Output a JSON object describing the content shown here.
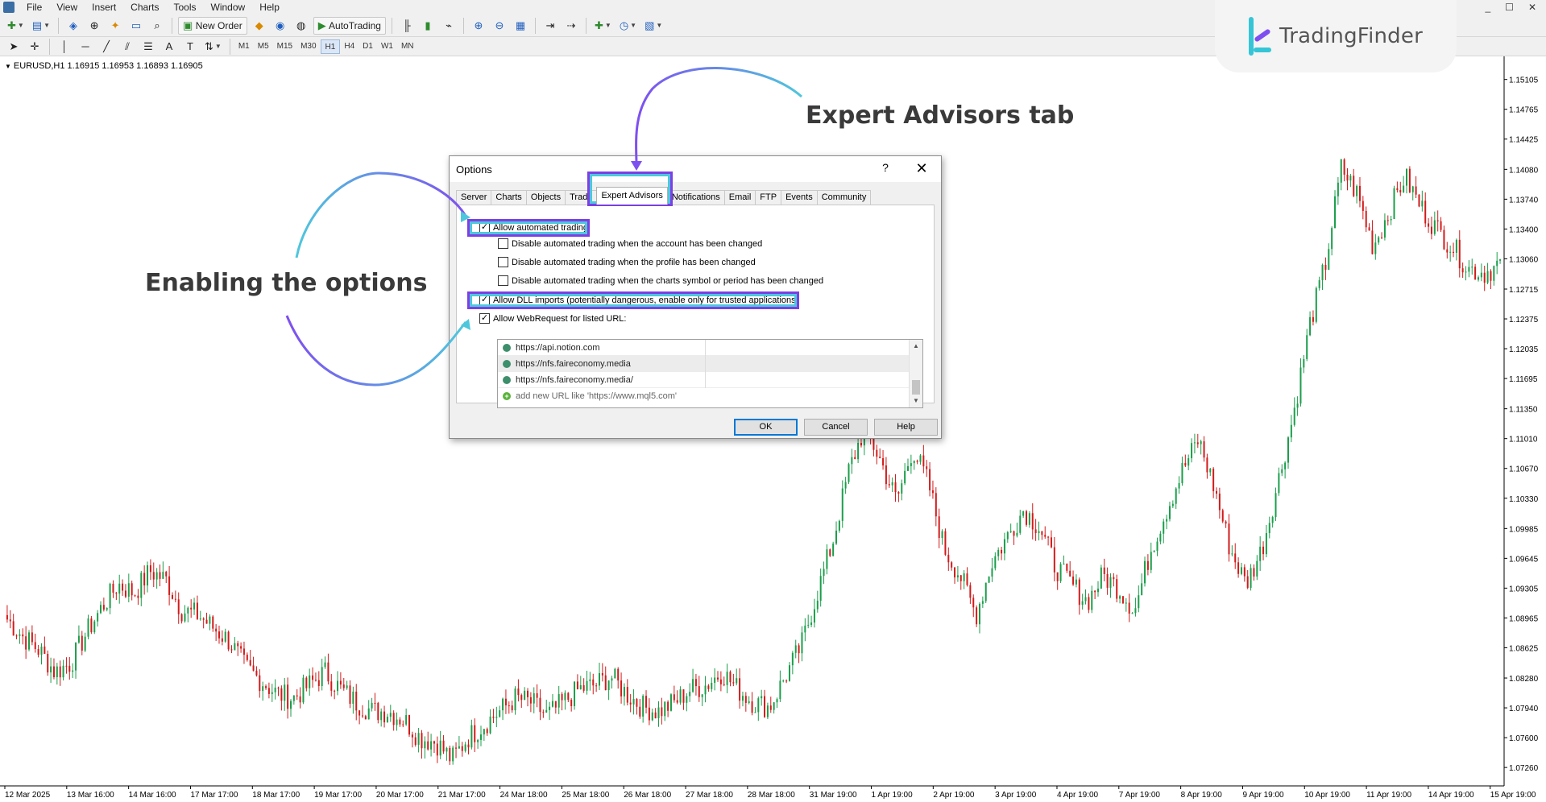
{
  "menu": {
    "items": [
      "File",
      "View",
      "Insert",
      "Charts",
      "Tools",
      "Window",
      "Help"
    ]
  },
  "window_controls": [
    "_",
    "☐",
    "✕"
  ],
  "toolbar": {
    "new_order_label": "New Order",
    "autotrading_label": "AutoTrading",
    "timeframes": [
      "M1",
      "M5",
      "M15",
      "M30",
      "H1",
      "H4",
      "D1",
      "W1",
      "MN"
    ],
    "active_timeframe": "H1"
  },
  "brand": {
    "name": "TradingFinder",
    "colors": {
      "cyan": "#35c5d6",
      "purple": "#7e4ff0"
    }
  },
  "chart_label": "EURUSD,H1  1.16915 1.16953 1.16893 1.16905",
  "annotations": {
    "expert_tab": "Expert Advisors tab",
    "enabling": "Enabling the options"
  },
  "dialog": {
    "title": "Options",
    "help_glyph": "?",
    "close_glyph": "✕",
    "tabs": [
      "Server",
      "Charts",
      "Objects",
      "Trade",
      "Expert Advisors",
      "Notifications",
      "Email",
      "FTP",
      "Events",
      "Community"
    ],
    "active_tab": "Expert Advisors",
    "options": [
      {
        "label": "Allow automated trading",
        "checked": true
      },
      {
        "label": "Disable automated trading when the account has been changed",
        "checked": false
      },
      {
        "label": "Disable automated trading when the profile has been changed",
        "checked": false
      },
      {
        "label": "Disable automated trading when the charts symbol or period has been changed",
        "checked": false
      },
      {
        "label": "Allow DLL imports (potentially dangerous, enable only for trusted applications)",
        "checked": true
      },
      {
        "label": "Allow WebRequest for listed URL:",
        "checked": true
      }
    ],
    "urls": [
      "https://api.notion.com",
      "https://nfs.faireconomy.media",
      "https://nfs.faireconomy.media/"
    ],
    "add_url_hint": "add new URL like 'https://www.mql5.com'",
    "buttons": {
      "ok": "OK",
      "cancel": "Cancel",
      "help": "Help"
    }
  },
  "highlight_colors": {
    "purple": "#7b3fe4",
    "cyan": "#4ec7dc"
  },
  "chart_data": {
    "type": "candlestick",
    "symbol": "EURUSD",
    "timeframe": "H1",
    "last_ohlc": [
      1.16915,
      1.16953,
      1.16893,
      1.16905
    ],
    "ylim": [
      1.0705,
      1.1535
    ],
    "price_ticks": [
      "1.15105",
      "1.14765",
      "1.14425",
      "1.14080",
      "1.13740",
      "1.13400",
      "1.13060",
      "1.12715",
      "1.12375",
      "1.12035",
      "1.11695",
      "1.11350",
      "1.11010",
      "1.10670",
      "1.10330",
      "1.09985",
      "1.09645",
      "1.09305",
      "1.08965",
      "1.08625",
      "1.08280",
      "1.07940",
      "1.07600",
      "1.07260"
    ],
    "time_ticks": [
      "12 Mar 2025",
      "13 Mar 16:00",
      "14 Mar 16:00",
      "17 Mar 17:00",
      "18 Mar 17:00",
      "19 Mar 17:00",
      "20 Mar 17:00",
      "21 Mar 17:00",
      "24 Mar 18:00",
      "25 Mar 18:00",
      "26 Mar 18:00",
      "27 Mar 18:00",
      "28 Mar 18:00",
      "31 Mar 19:00",
      "1 Apr 19:00",
      "2 Apr 19:00",
      "3 Apr 19:00",
      "4 Apr 19:00",
      "7 Apr 19:00",
      "8 Apr 19:00",
      "9 Apr 19:00",
      "10 Apr 19:00",
      "11 Apr 19:00",
      "14 Apr 19:00",
      "15 Apr 19:00"
    ],
    "series": [
      {
        "name": "close",
        "values": [
          1.0895,
          1.0875,
          1.086,
          1.0835,
          1.0845,
          1.088,
          1.091,
          1.0935,
          1.0925,
          1.095,
          1.094,
          1.0905,
          1.09,
          1.0885,
          1.087,
          1.084,
          1.0825,
          1.081,
          1.0805,
          1.082,
          1.0835,
          1.0815,
          1.08,
          1.079,
          1.079,
          1.078,
          1.076,
          1.0755,
          1.0735,
          1.076,
          1.0775,
          1.079,
          1.0805,
          1.08,
          1.0785,
          1.08,
          1.0815,
          1.082,
          1.083,
          1.081,
          1.0795,
          1.079,
          1.08,
          1.0815,
          1.082,
          1.0835,
          1.0815,
          1.08,
          1.0795,
          1.083,
          1.0865,
          1.0925,
          1.0985,
          1.1065,
          1.1115,
          1.1075,
          1.103,
          1.109,
          1.105,
          1.0975,
          1.0945,
          1.09,
          1.096,
          1.099,
          1.102,
          1.1,
          1.0955,
          1.0935,
          1.0915,
          1.0945,
          1.093,
          1.0905,
          1.0975,
          1.102,
          1.1065,
          1.11,
          1.1045,
          1.0975,
          1.0935,
          1.0975,
          1.105,
          1.113,
          1.123,
          1.13,
          1.141,
          1.138,
          1.132,
          1.136,
          1.14,
          1.1365,
          1.134,
          1.132,
          1.1295,
          1.129,
          1.13
        ]
      }
    ]
  }
}
